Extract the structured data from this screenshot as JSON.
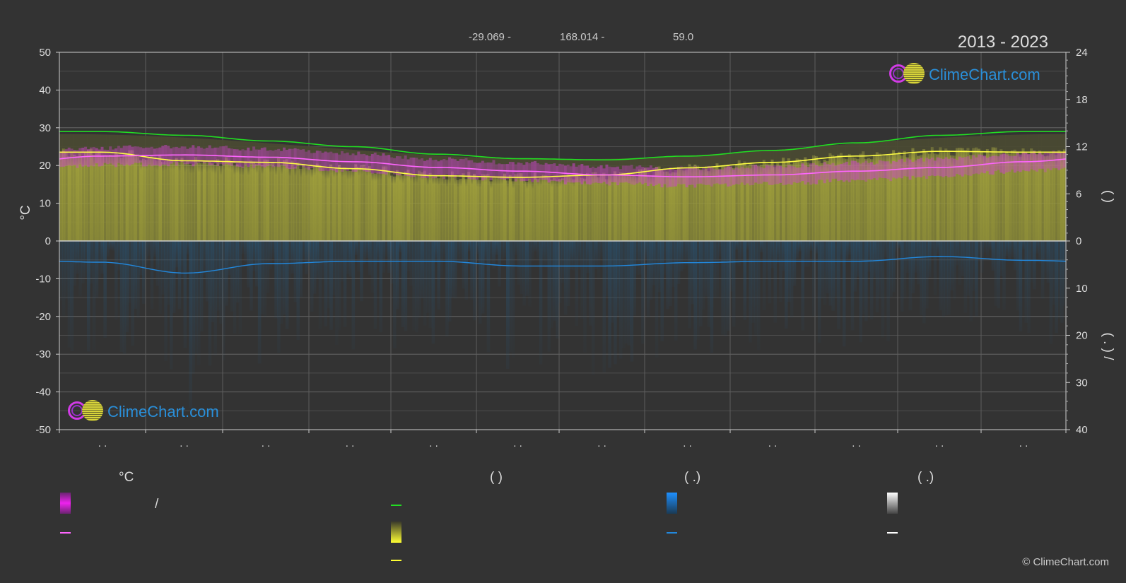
{
  "header": {
    "lat": "-29.069 -",
    "lon": "168.014 -",
    "elev": "59.0",
    "years": "2013 - 2023"
  },
  "brand": {
    "name": "ClimeChart.com",
    "copyright": "© ClimeChart.com"
  },
  "colors": {
    "background": "#333333",
    "maxTemp": "#22dd22",
    "sunshine": "#ffff44",
    "avgTemp": "#ff66ff",
    "rain": "#2288dd",
    "sunBand": "#9c9c3a",
    "tempBand": "#cc44cc"
  },
  "legend": {
    "col1_title": "°C",
    "col1_item1": "/",
    "col2_title": "(          )",
    "col3_title": "(   .)",
    "col4_title": "(   .)"
  },
  "chart_data": {
    "type": "area",
    "title": "",
    "ylabel_left": "°C",
    "ylim_left": [
      -50,
      50
    ],
    "yticks_left": [
      50,
      40,
      30,
      20,
      10,
      0,
      -10,
      -20,
      -30,
      -40,
      -50
    ],
    "ylabel_right_top": "(     )",
    "yticks_right_top": [
      24,
      18,
      12,
      6,
      0
    ],
    "ylabel_right_bottom": "(  .  )   /",
    "yticks_right_bottom": [
      0,
      10,
      20,
      30,
      40
    ],
    "month_labels": [
      ". .",
      ". .",
      ". .",
      ". .",
      ". .",
      ". .",
      ". .",
      ". .",
      ". .",
      ". .",
      ". .",
      ". ."
    ],
    "x": [
      0.5,
      1.5,
      2.5,
      3.5,
      4.5,
      5.5,
      6.5,
      7.5,
      8.5,
      9.5,
      10.5,
      11.5
    ],
    "series": [
      {
        "key": "maxTemp",
        "values": [
          29.0,
          28.0,
          26.5,
          25.0,
          23.0,
          21.8,
          21.5,
          22.5,
          24.0,
          26.0,
          28.0,
          29.0
        ]
      },
      {
        "key": "avgTemp",
        "values": [
          22.5,
          22.8,
          22.2,
          21.0,
          19.5,
          18.5,
          17.5,
          17.0,
          17.5,
          18.5,
          19.5,
          21.0
        ]
      },
      {
        "key": "sunshineHours",
        "values": [
          11.3,
          10.2,
          10.0,
          9.2,
          8.3,
          8.1,
          8.4,
          9.3,
          10.0,
          10.8,
          11.4,
          11.3
        ]
      },
      {
        "key": "rainMm",
        "values": [
          4.5,
          6.8,
          4.8,
          4.3,
          4.3,
          5.3,
          5.3,
          4.6,
          4.3,
          4.3,
          3.3,
          4.1
        ]
      }
    ]
  }
}
